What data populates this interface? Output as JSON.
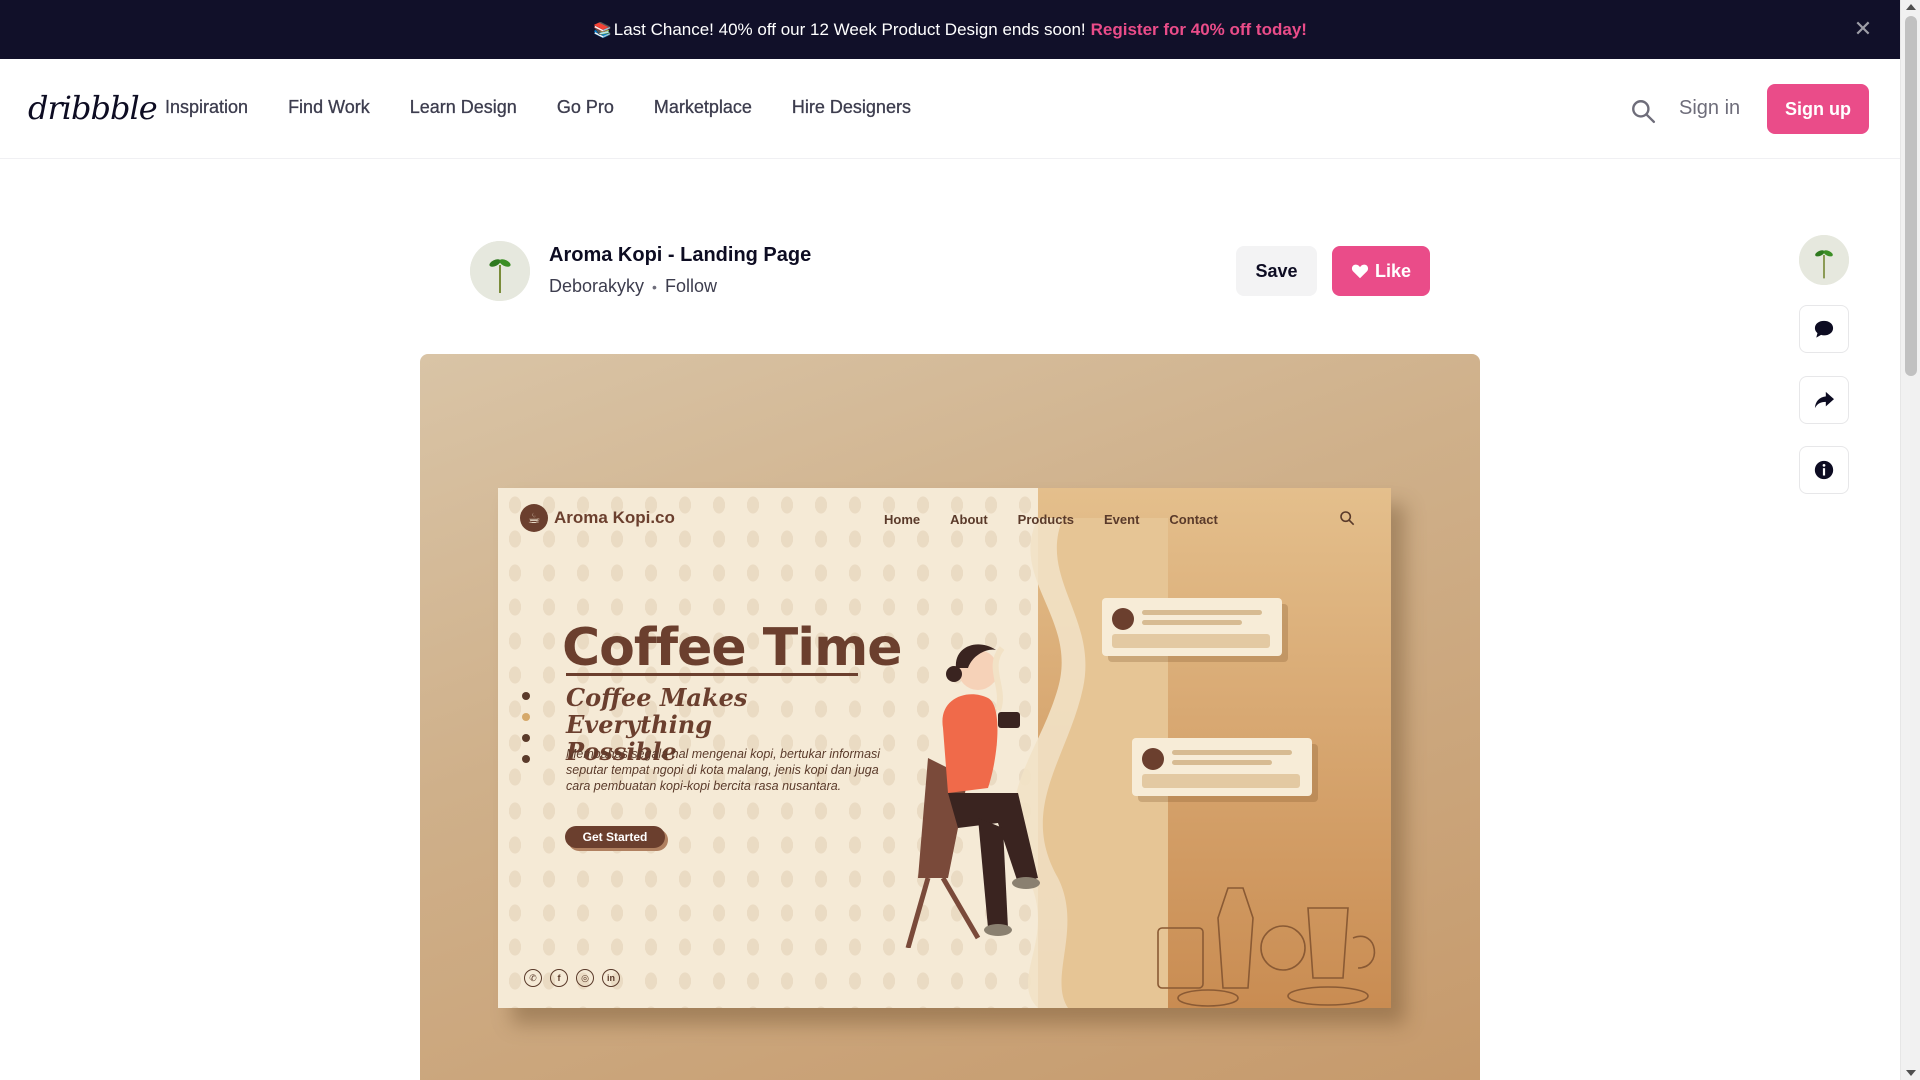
{
  "banner": {
    "icon": "books-emoji-icon",
    "message": "Last Chance! 40% off our 12 Week Product Design ends soon!",
    "cta": "Register for 40% off today!",
    "close": "✕"
  },
  "nav": {
    "logo": "dribbble",
    "links": [
      "Inspiration",
      "Find Work",
      "Learn Design",
      "Go Pro",
      "Marketplace",
      "Hire Designers"
    ],
    "sign_in": "Sign in",
    "sign_up": "Sign up"
  },
  "shot": {
    "title": "Aroma Kopi - Landing Page",
    "author": "Deborakyky",
    "separator": "•",
    "follow": "Follow",
    "save": "Save",
    "like": "Like"
  },
  "mockup": {
    "brand": "Aroma Kopi.co",
    "nav": [
      "Home",
      "About",
      "Products",
      "Event",
      "Contact"
    ],
    "headline": "Coffee Time",
    "tagline_1": "Coffee Makes",
    "tagline_2": "Everything Possible",
    "description": "Membahas segala hal mengenai kopi, bertukar informasi seputar tempat ngopi di kota malang, jenis kopi dan juga cara pembuatan kopi-kopi bercita rasa nusantara.",
    "cta": "Get Started",
    "social": [
      "whatsapp-icon",
      "facebook-icon",
      "instagram-icon",
      "linkedin-icon"
    ]
  },
  "colors": {
    "brand_pink": "#ea4c89",
    "banner_bg": "#111029",
    "coffee_brown": "#6b3f2e"
  }
}
